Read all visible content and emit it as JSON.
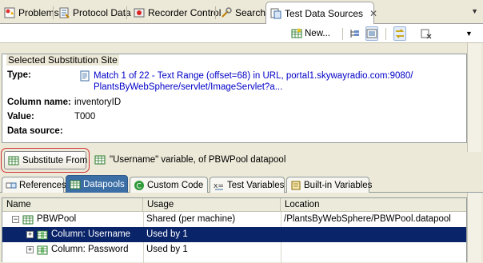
{
  "view_tabs": [
    {
      "label": "Problems",
      "icon": "problems-icon"
    },
    {
      "label": "Protocol Data",
      "icon": "protocol-data-icon"
    },
    {
      "label": "Recorder Control",
      "icon": "recorder-control-icon"
    },
    {
      "label": "Search",
      "icon": "search-icon"
    },
    {
      "label": "Test Data Sources",
      "icon": "test-data-sources-icon",
      "active": true
    }
  ],
  "toolbar": {
    "new_label": "New..."
  },
  "substitution_site": {
    "title": "Selected Substitution Site",
    "type_label": "Type:",
    "type_value_line1": "Match 1 of 22 - Text Range (offset=68) in URL, portal1.skywayradio.com:9080/",
    "type_value_line2": "PlantsByWebSphere/servlet/ImageServlet?a...",
    "column_name_label": "Column name:",
    "column_name_value": "inventoryID",
    "value_label": "Value:",
    "value_value": "T000",
    "data_source_label": "Data source:",
    "data_source_value": ""
  },
  "substitute": {
    "button_label": "Substitute From",
    "info": "\"Username\" variable, of PBWPool datapool"
  },
  "bottom_tabs": [
    {
      "label": "References",
      "icon": "references-icon"
    },
    {
      "label": "Datapools",
      "icon": "datapools-icon",
      "active": true
    },
    {
      "label": "Custom Code",
      "icon": "custom-code-icon"
    },
    {
      "label": "Test Variables",
      "icon": "test-variables-icon"
    },
    {
      "label": "Built-in Variables",
      "icon": "built-in-variables-icon"
    }
  ],
  "table": {
    "columns": [
      "Name",
      "Usage",
      "Location"
    ],
    "rows": [
      {
        "name": "PBWPool",
        "usage": "Shared (per machine)",
        "location": "/PlantsByWebSphere/PBWPool.datapool",
        "expander": "−"
      },
      {
        "name": "Column: Username",
        "usage": "Used by 1",
        "location": "",
        "expander": "+",
        "selected": true
      },
      {
        "name": "Column: Password",
        "usage": "Used by 1",
        "location": "",
        "expander": "+"
      }
    ]
  },
  "colors": {
    "selection": "#0a246a",
    "active_tab": "#3a6ea5",
    "highlight_outline": "#d03030",
    "link_blue": "#0000c8"
  }
}
